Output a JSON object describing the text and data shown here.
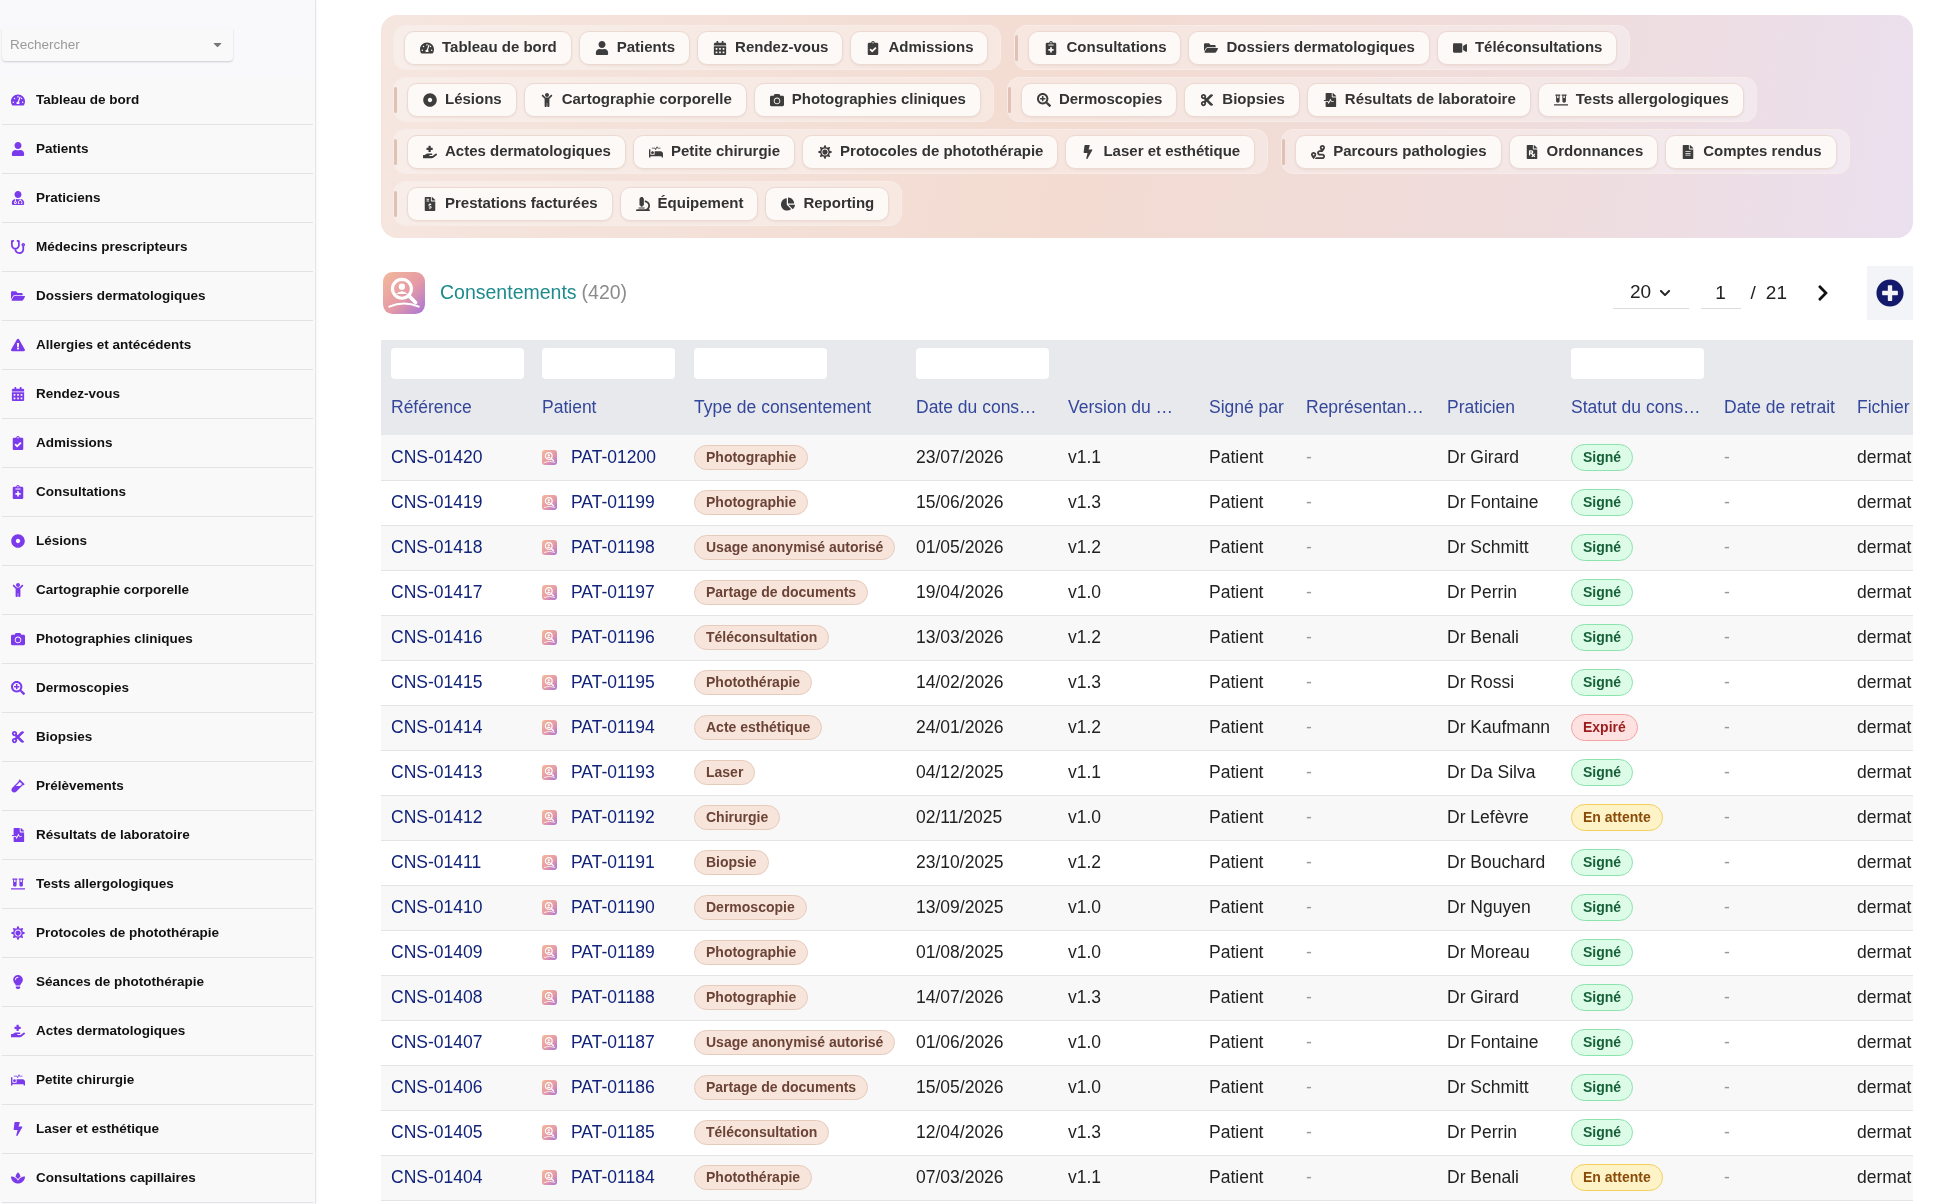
{
  "sidebar": {
    "search": {
      "placeholder": "Rechercher"
    },
    "items": [
      {
        "label": "Tableau de bord"
      },
      {
        "label": "Patients"
      },
      {
        "label": "Praticiens"
      },
      {
        "label": "Médecins prescripteurs"
      },
      {
        "label": "Dossiers dermatologiques"
      },
      {
        "label": "Allergies et antécédents"
      },
      {
        "label": "Rendez-vous"
      },
      {
        "label": "Admissions"
      },
      {
        "label": "Consultations"
      },
      {
        "label": "Lésions"
      },
      {
        "label": "Cartographie corporelle"
      },
      {
        "label": "Photographies cliniques"
      },
      {
        "label": "Dermoscopies"
      },
      {
        "label": "Biopsies"
      },
      {
        "label": "Prélèvements"
      },
      {
        "label": "Résultats de laboratoire"
      },
      {
        "label": "Tests allergologiques"
      },
      {
        "label": "Protocoles de photothérapie"
      },
      {
        "label": "Séances de photothérapie"
      },
      {
        "label": "Actes dermatologiques"
      },
      {
        "label": "Petite chirurgie"
      },
      {
        "label": "Laser et esthétique"
      },
      {
        "label": "Consultations capillaires"
      }
    ]
  },
  "nav": {
    "rows": [
      {
        "groups": [
          {
            "items": [
              {
                "label": "Tableau de bord"
              },
              {
                "label": "Patients"
              },
              {
                "label": "Rendez-vous"
              },
              {
                "label": "Admissions"
              }
            ]
          },
          {
            "items": [
              {
                "label": "Consultations"
              },
              {
                "label": "Dossiers dermatologiques"
              },
              {
                "label": "Téléconsultations"
              }
            ]
          }
        ]
      },
      {
        "groups": [
          {
            "items": [
              {
                "label": "Lésions"
              },
              {
                "label": "Cartographie corporelle"
              },
              {
                "label": "Photographies cliniques"
              }
            ]
          },
          {
            "items": [
              {
                "label": "Dermoscopies"
              },
              {
                "label": "Biopsies"
              },
              {
                "label": "Résultats de laboratoire"
              },
              {
                "label": "Tests allergologiques"
              }
            ]
          }
        ]
      },
      {
        "groups": [
          {
            "items": [
              {
                "label": "Actes dermatologiques"
              },
              {
                "label": "Petite chirurgie"
              },
              {
                "label": "Protocoles de photothérapie"
              },
              {
                "label": "Laser et esthétique"
              }
            ]
          },
          {
            "items": [
              {
                "label": "Parcours pathologies"
              },
              {
                "label": "Ordonnances"
              },
              {
                "label": "Comptes rendus"
              }
            ]
          }
        ]
      },
      {
        "groups": [
          {
            "items": [
              {
                "label": "Prestations facturées"
              },
              {
                "label": "Équipement"
              },
              {
                "label": "Reporting"
              }
            ]
          }
        ]
      }
    ]
  },
  "header": {
    "title": "Consentements",
    "count": "(420)"
  },
  "pagination": {
    "page_size": "20",
    "page": "1",
    "separator": "/",
    "total_pages": "21"
  },
  "table": {
    "columns": [
      {
        "label": "Référence",
        "filter": true
      },
      {
        "label": "Patient",
        "filter": true
      },
      {
        "label": "Type de consentement",
        "filter": true
      },
      {
        "label": "Date du cons…",
        "filter": true
      },
      {
        "label": "Version du …",
        "filter": false
      },
      {
        "label": "Signé par",
        "filter": false
      },
      {
        "label": "Représentan…",
        "filter": false
      },
      {
        "label": "Praticien",
        "filter": false
      },
      {
        "label": "Statut du cons…",
        "filter": true
      },
      {
        "label": "Date de retrait",
        "filter": false
      },
      {
        "label": "Fichier",
        "filter": false
      }
    ],
    "rows": [
      {
        "reference": "CNS-01420",
        "patient": "PAT-01200",
        "type": "Photographie",
        "date": "23/07/2026",
        "version": "v1.1",
        "signed_by": "Patient",
        "representative": "-",
        "practitioner": "Dr Girard",
        "status": {
          "label": "Signé",
          "kind": "success"
        },
        "withdrawal_date": "-",
        "file": "dermat"
      },
      {
        "reference": "CNS-01419",
        "patient": "PAT-01199",
        "type": "Photographie",
        "date": "15/06/2026",
        "version": "v1.3",
        "signed_by": "Patient",
        "representative": "-",
        "practitioner": "Dr Fontaine",
        "status": {
          "label": "Signé",
          "kind": "success"
        },
        "withdrawal_date": "-",
        "file": "dermat"
      },
      {
        "reference": "CNS-01418",
        "patient": "PAT-01198",
        "type": "Usage anonymisé autorisé",
        "date": "01/05/2026",
        "version": "v1.2",
        "signed_by": "Patient",
        "representative": "-",
        "practitioner": "Dr Schmitt",
        "status": {
          "label": "Signé",
          "kind": "success"
        },
        "withdrawal_date": "-",
        "file": "dermat"
      },
      {
        "reference": "CNS-01417",
        "patient": "PAT-01197",
        "type": "Partage de documents",
        "date": "19/04/2026",
        "version": "v1.0",
        "signed_by": "Patient",
        "representative": "-",
        "practitioner": "Dr Perrin",
        "status": {
          "label": "Signé",
          "kind": "success"
        },
        "withdrawal_date": "-",
        "file": "dermat"
      },
      {
        "reference": "CNS-01416",
        "patient": "PAT-01196",
        "type": "Téléconsultation",
        "date": "13/03/2026",
        "version": "v1.2",
        "signed_by": "Patient",
        "representative": "-",
        "practitioner": "Dr Benali",
        "status": {
          "label": "Signé",
          "kind": "success"
        },
        "withdrawal_date": "-",
        "file": "dermat"
      },
      {
        "reference": "CNS-01415",
        "patient": "PAT-01195",
        "type": "Photothérapie",
        "date": "14/02/2026",
        "version": "v1.3",
        "signed_by": "Patient",
        "representative": "-",
        "practitioner": "Dr Rossi",
        "status": {
          "label": "Signé",
          "kind": "success"
        },
        "withdrawal_date": "-",
        "file": "dermat"
      },
      {
        "reference": "CNS-01414",
        "patient": "PAT-01194",
        "type": "Acte esthétique",
        "date": "24/01/2026",
        "version": "v1.2",
        "signed_by": "Patient",
        "representative": "-",
        "practitioner": "Dr Kaufmann",
        "status": {
          "label": "Expiré",
          "kind": "danger"
        },
        "withdrawal_date": "-",
        "file": "dermat"
      },
      {
        "reference": "CNS-01413",
        "patient": "PAT-01193",
        "type": "Laser",
        "date": "04/12/2025",
        "version": "v1.1",
        "signed_by": "Patient",
        "representative": "-",
        "practitioner": "Dr Da Silva",
        "status": {
          "label": "Signé",
          "kind": "success"
        },
        "withdrawal_date": "-",
        "file": "dermat"
      },
      {
        "reference": "CNS-01412",
        "patient": "PAT-01192",
        "type": "Chirurgie",
        "date": "02/11/2025",
        "version": "v1.0",
        "signed_by": "Patient",
        "representative": "-",
        "practitioner": "Dr Lefèvre",
        "status": {
          "label": "En attente",
          "kind": "warning"
        },
        "withdrawal_date": "-",
        "file": "dermat"
      },
      {
        "reference": "CNS-01411",
        "patient": "PAT-01191",
        "type": "Biopsie",
        "date": "23/10/2025",
        "version": "v1.2",
        "signed_by": "Patient",
        "representative": "-",
        "practitioner": "Dr Bouchard",
        "status": {
          "label": "Signé",
          "kind": "success"
        },
        "withdrawal_date": "-",
        "file": "dermat"
      },
      {
        "reference": "CNS-01410",
        "patient": "PAT-01190",
        "type": "Dermoscopie",
        "date": "13/09/2025",
        "version": "v1.0",
        "signed_by": "Patient",
        "representative": "-",
        "practitioner": "Dr Nguyen",
        "status": {
          "label": "Signé",
          "kind": "success"
        },
        "withdrawal_date": "-",
        "file": "dermat"
      },
      {
        "reference": "CNS-01409",
        "patient": "PAT-01189",
        "type": "Photographie",
        "date": "01/08/2025",
        "version": "v1.0",
        "signed_by": "Patient",
        "representative": "-",
        "practitioner": "Dr Moreau",
        "status": {
          "label": "Signé",
          "kind": "success"
        },
        "withdrawal_date": "-",
        "file": "dermat"
      },
      {
        "reference": "CNS-01408",
        "patient": "PAT-01188",
        "type": "Photographie",
        "date": "14/07/2026",
        "version": "v1.3",
        "signed_by": "Patient",
        "representative": "-",
        "practitioner": "Dr Girard",
        "status": {
          "label": "Signé",
          "kind": "success"
        },
        "withdrawal_date": "-",
        "file": "dermat"
      },
      {
        "reference": "CNS-01407",
        "patient": "PAT-01187",
        "type": "Usage anonymisé autorisé",
        "date": "01/06/2026",
        "version": "v1.0",
        "signed_by": "Patient",
        "representative": "-",
        "practitioner": "Dr Fontaine",
        "status": {
          "label": "Signé",
          "kind": "success"
        },
        "withdrawal_date": "-",
        "file": "dermat"
      },
      {
        "reference": "CNS-01406",
        "patient": "PAT-01186",
        "type": "Partage de documents",
        "date": "15/05/2026",
        "version": "v1.0",
        "signed_by": "Patient",
        "representative": "-",
        "practitioner": "Dr Schmitt",
        "status": {
          "label": "Signé",
          "kind": "success"
        },
        "withdrawal_date": "-",
        "file": "dermat"
      },
      {
        "reference": "CNS-01405",
        "patient": "PAT-01185",
        "type": "Téléconsultation",
        "date": "12/04/2026",
        "version": "v1.3",
        "signed_by": "Patient",
        "representative": "-",
        "practitioner": "Dr Perrin",
        "status": {
          "label": "Signé",
          "kind": "success"
        },
        "withdrawal_date": "-",
        "file": "dermat"
      },
      {
        "reference": "CNS-01404",
        "patient": "PAT-01184",
        "type": "Photothérapie",
        "date": "07/03/2026",
        "version": "v1.1",
        "signed_by": "Patient",
        "representative": "-",
        "practitioner": "Dr Benali",
        "status": {
          "label": "En attente",
          "kind": "warning"
        },
        "withdrawal_date": "-",
        "file": "dermat"
      }
    ]
  }
}
